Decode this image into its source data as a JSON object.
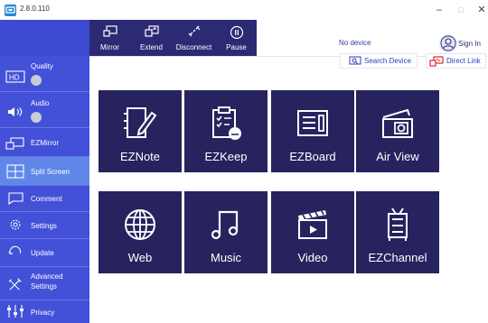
{
  "app": {
    "version": "2.8.0.110"
  },
  "window": {
    "minimize": "–",
    "maximize": "□",
    "close": "✕"
  },
  "toolbar": [
    {
      "label": "Mirror",
      "icon": "mirror-icon"
    },
    {
      "label": "Extend",
      "icon": "extend-icon"
    },
    {
      "label": "Disconnect",
      "icon": "disconnect-icon"
    },
    {
      "label": "Pause",
      "icon": "pause-icon"
    }
  ],
  "device": {
    "status": "No device",
    "sign_in": "Sign In",
    "search_device": "Search Device",
    "direct_link": "Direct Link"
  },
  "sidebar": [
    {
      "label": "Quality",
      "icon": "hd-icon",
      "toggle": true
    },
    {
      "label": "Audio",
      "icon": "speaker-icon",
      "toggle": true
    },
    {
      "label": "EZMirror",
      "icon": "ezmirror-icon"
    },
    {
      "label": "Split Screen",
      "icon": "split-screen-icon",
      "active": true
    },
    {
      "label": "Comment",
      "icon": "comment-icon"
    },
    {
      "label": "Settings",
      "icon": "gear-icon"
    },
    {
      "label": "Update",
      "icon": "refresh-icon"
    },
    {
      "label": "Advanced\nSettings",
      "icon": "tools-icon"
    },
    {
      "label": "Privacy",
      "icon": "privacy-icon"
    }
  ],
  "tiles": [
    {
      "label": "EZNote",
      "icon": "notebook-pen-icon"
    },
    {
      "label": "EZKeep",
      "icon": "clipboard-cloud-icon"
    },
    {
      "label": "EZBoard",
      "icon": "whiteboard-icon"
    },
    {
      "label": "Air View",
      "icon": "camera-screen-icon"
    },
    {
      "label": "Web",
      "icon": "globe-icon"
    },
    {
      "label": "Music",
      "icon": "music-note-icon"
    },
    {
      "label": "Video",
      "icon": "clapperboard-icon"
    },
    {
      "label": "EZChannel",
      "icon": "tv-channel-icon"
    }
  ],
  "colors": {
    "sidebar": "#3b4ad0",
    "sidebar_active": "#5f87ea",
    "toolbar": "#2c2a73",
    "tile": "#26235f",
    "accent_red": "#e0262c"
  }
}
